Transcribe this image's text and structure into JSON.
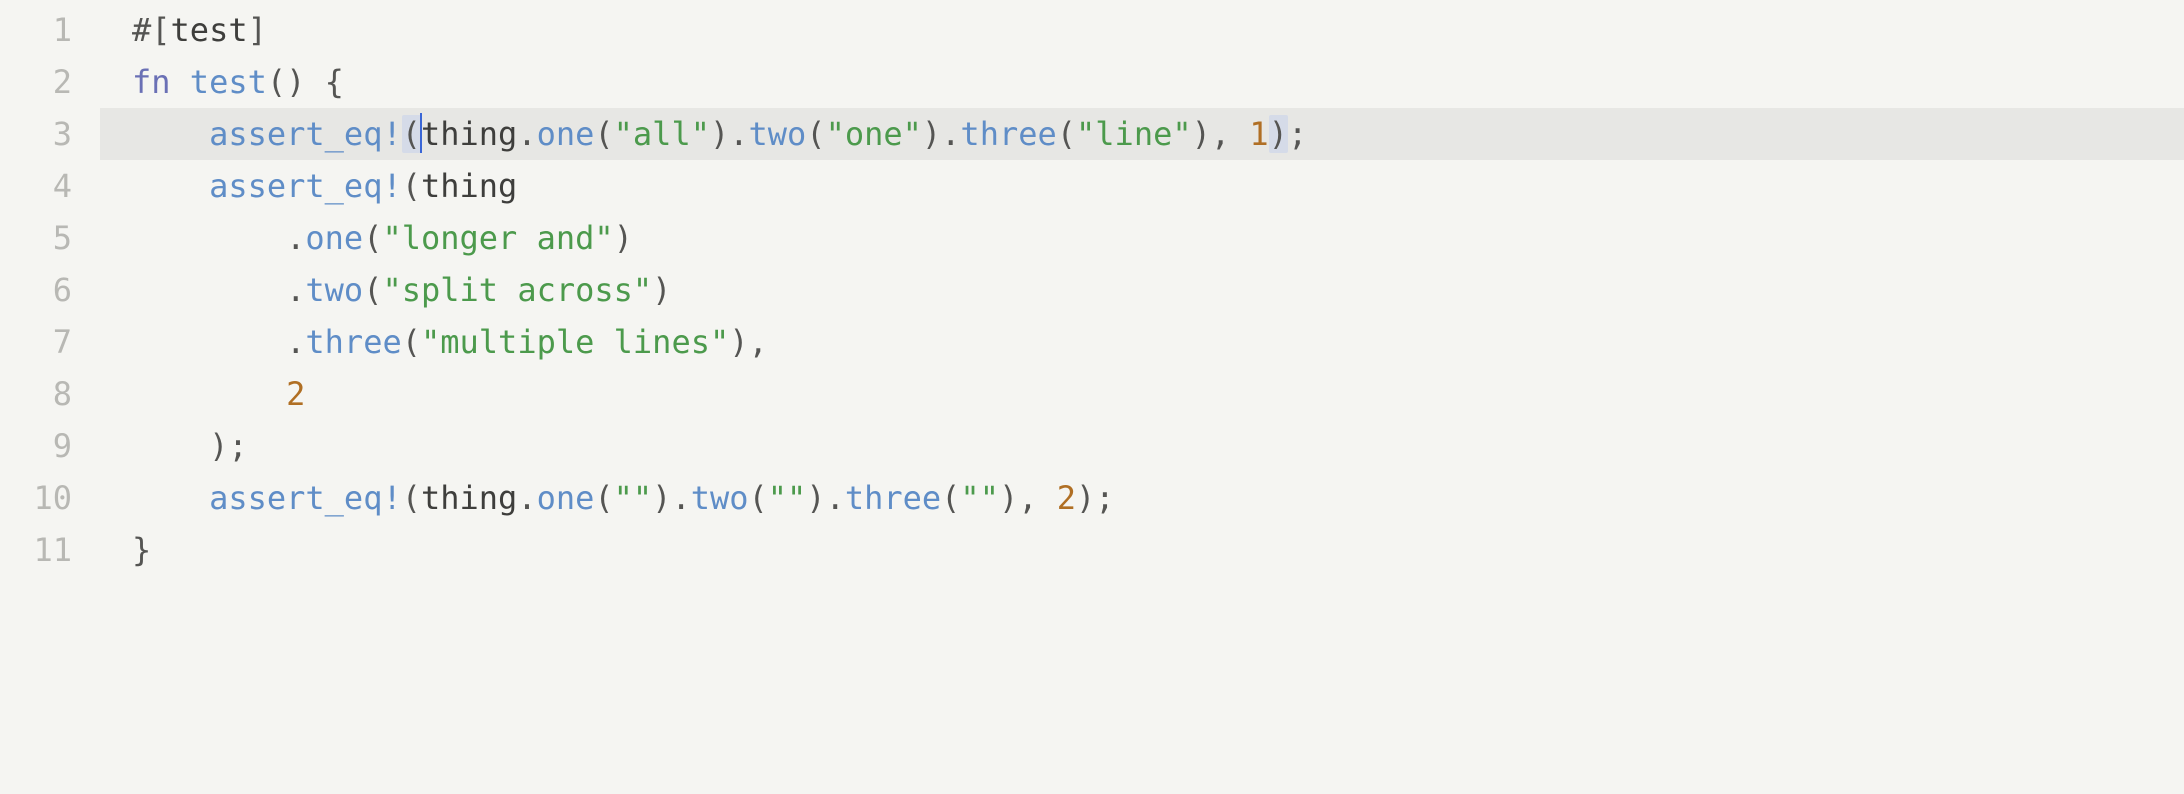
{
  "gutter": [
    "1",
    "2",
    "3",
    "4",
    "5",
    "6",
    "7",
    "8",
    "9",
    "10",
    "11"
  ],
  "active_line_index": 2,
  "lines": [
    [
      {
        "t": "#[",
        "c": "c-punct"
      },
      {
        "t": "test",
        "c": "c-ident"
      },
      {
        "t": "]",
        "c": "c-punct"
      }
    ],
    [
      {
        "t": "fn",
        "c": "c-keyword"
      },
      {
        "t": " ",
        "c": ""
      },
      {
        "t": "test",
        "c": "c-method"
      },
      {
        "t": "()",
        "c": "c-punct"
      },
      {
        "t": " ",
        "c": ""
      },
      {
        "t": "{",
        "c": "c-punct"
      }
    ],
    [
      {
        "t": "    ",
        "c": ""
      },
      {
        "t": "assert_eq!",
        "c": "c-macro"
      },
      {
        "t": "(",
        "c": "c-punct",
        "hl": true
      },
      {
        "cursor": true
      },
      {
        "t": "thing",
        "c": "c-ident"
      },
      {
        "t": ".",
        "c": "c-punct"
      },
      {
        "t": "one",
        "c": "c-method"
      },
      {
        "t": "(",
        "c": "c-punct"
      },
      {
        "t": "\"all\"",
        "c": "c-string"
      },
      {
        "t": ")",
        "c": "c-punct"
      },
      {
        "t": ".",
        "c": "c-punct"
      },
      {
        "t": "two",
        "c": "c-method"
      },
      {
        "t": "(",
        "c": "c-punct"
      },
      {
        "t": "\"one\"",
        "c": "c-string"
      },
      {
        "t": ")",
        "c": "c-punct"
      },
      {
        "t": ".",
        "c": "c-punct"
      },
      {
        "t": "three",
        "c": "c-method"
      },
      {
        "t": "(",
        "c": "c-punct"
      },
      {
        "t": "\"line\"",
        "c": "c-string"
      },
      {
        "t": ")",
        "c": "c-punct"
      },
      {
        "t": ", ",
        "c": "c-punct"
      },
      {
        "t": "1",
        "c": "c-num"
      },
      {
        "t": ")",
        "c": "c-punct",
        "hl": true
      },
      {
        "t": ";",
        "c": "c-punct"
      }
    ],
    [
      {
        "t": "    ",
        "c": ""
      },
      {
        "t": "assert_eq!",
        "c": "c-macro"
      },
      {
        "t": "(",
        "c": "c-punct"
      },
      {
        "t": "thing",
        "c": "c-ident"
      }
    ],
    [
      {
        "t": "        .",
        "c": "c-punct"
      },
      {
        "t": "one",
        "c": "c-method"
      },
      {
        "t": "(",
        "c": "c-punct"
      },
      {
        "t": "\"longer and\"",
        "c": "c-string"
      },
      {
        "t": ")",
        "c": "c-punct"
      }
    ],
    [
      {
        "t": "        .",
        "c": "c-punct"
      },
      {
        "t": "two",
        "c": "c-method"
      },
      {
        "t": "(",
        "c": "c-punct"
      },
      {
        "t": "\"split across\"",
        "c": "c-string"
      },
      {
        "t": ")",
        "c": "c-punct"
      }
    ],
    [
      {
        "t": "        .",
        "c": "c-punct"
      },
      {
        "t": "three",
        "c": "c-method"
      },
      {
        "t": "(",
        "c": "c-punct"
      },
      {
        "t": "\"multiple lines\"",
        "c": "c-string"
      },
      {
        "t": ")",
        "c": "c-punct"
      },
      {
        "t": ",",
        "c": "c-punct"
      }
    ],
    [
      {
        "t": "        ",
        "c": ""
      },
      {
        "t": "2",
        "c": "c-num"
      }
    ],
    [
      {
        "t": "    );",
        "c": "c-punct"
      }
    ],
    [
      {
        "t": "    ",
        "c": ""
      },
      {
        "t": "assert_eq!",
        "c": "c-macro"
      },
      {
        "t": "(",
        "c": "c-punct"
      },
      {
        "t": "thing",
        "c": "c-ident"
      },
      {
        "t": ".",
        "c": "c-punct"
      },
      {
        "t": "one",
        "c": "c-method"
      },
      {
        "t": "(",
        "c": "c-punct"
      },
      {
        "t": "\"\"",
        "c": "c-string"
      },
      {
        "t": ")",
        "c": "c-punct"
      },
      {
        "t": ".",
        "c": "c-punct"
      },
      {
        "t": "two",
        "c": "c-method"
      },
      {
        "t": "(",
        "c": "c-punct"
      },
      {
        "t": "\"\"",
        "c": "c-string"
      },
      {
        "t": ")",
        "c": "c-punct"
      },
      {
        "t": ".",
        "c": "c-punct"
      },
      {
        "t": "three",
        "c": "c-method"
      },
      {
        "t": "(",
        "c": "c-punct"
      },
      {
        "t": "\"\"",
        "c": "c-string"
      },
      {
        "t": ")",
        "c": "c-punct"
      },
      {
        "t": ", ",
        "c": "c-punct"
      },
      {
        "t": "2",
        "c": "c-num"
      },
      {
        "t": ");",
        "c": "c-punct"
      }
    ],
    [
      {
        "t": "}",
        "c": "c-punct"
      }
    ]
  ]
}
